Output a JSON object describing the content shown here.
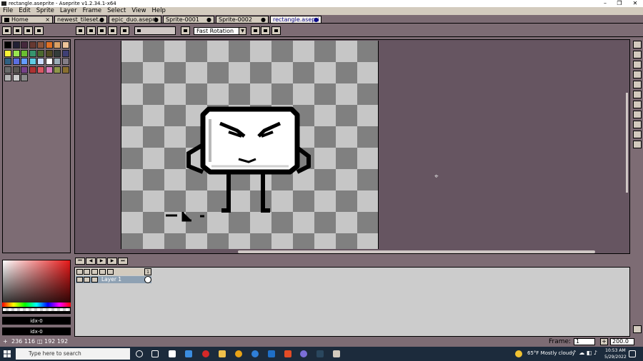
{
  "window": {
    "title": "rectangle.aseprite - Aseprite v1.2.34.1-x64",
    "minimize": "–",
    "maximize": "❐",
    "close": "✕"
  },
  "menu": [
    "File",
    "Edit",
    "Sprite",
    "Layer",
    "Frame",
    "Select",
    "View",
    "Help"
  ],
  "tabs": [
    {
      "label": "Home",
      "close": "×"
    },
    {
      "label": "newest_tileset.a",
      "close": "●"
    },
    {
      "label": "epic_duo.asepri",
      "close": "●"
    },
    {
      "label": "Sprite-0001",
      "close": "●"
    },
    {
      "label": "Sprite-0002",
      "close": "●"
    },
    {
      "label": "rectangle.asepri",
      "close": "●"
    }
  ],
  "context_bar": {
    "rotation_algorithm": "Fast Rotation",
    "dropdown_arrow": "▼"
  },
  "palette": {
    "colors": [
      "#000000",
      "#222034",
      "#45283c",
      "#663931",
      "#8f563b",
      "#df7126",
      "#d9a066",
      "#eec39a",
      "#fbf236",
      "#99e550",
      "#6abe30",
      "#37946e",
      "#4b692f",
      "#524b24",
      "#323c39",
      "#3f3f74",
      "#306082",
      "#5b6ee1",
      "#639bff",
      "#5fcde4",
      "#cbdbfc",
      "#ffffff",
      "#9badb7",
      "#847e87",
      "#696a6a",
      "#595652",
      "#76428a",
      "#ac3232",
      "#d95763",
      "#d77bba",
      "#8f974a",
      "#8a6f30"
    ],
    "extra": [
      "#b5b5b5",
      "#cdcdcd",
      "#8a8a8a"
    ]
  },
  "color_bar": {
    "fg_index": "idx-0",
    "bg_index": "idx-0"
  },
  "timeline": {
    "buttons": [
      "⏮",
      "◀",
      "▶",
      "▶",
      "⏭"
    ],
    "layer_name": "Layer 1",
    "frame_number": "1"
  },
  "status": {
    "cursor_pos": "236 116",
    "sprite_size": "192 192",
    "frame_label": "Frame:",
    "frame_value": "1",
    "plus": "+",
    "zoom": "200.0"
  },
  "taskbar": {
    "search_placeholder": "Type here to search",
    "weather": "65°F  Mostly cloudy",
    "time": "10:53 AM",
    "date": "5/29/2022"
  }
}
